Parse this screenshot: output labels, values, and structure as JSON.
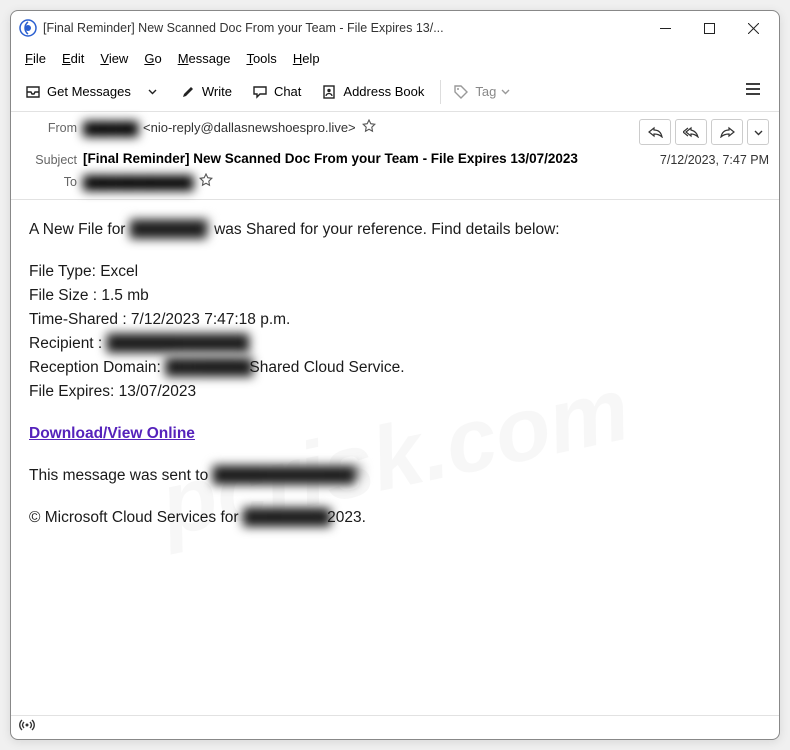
{
  "window": {
    "title": "[Final Reminder] New Scanned Doc From your Team - File Expires 13/..."
  },
  "menubar": {
    "file": "File",
    "edit": "Edit",
    "view": "View",
    "go": "Go",
    "message": "Message",
    "tools": "Tools",
    "help": "Help"
  },
  "toolbar": {
    "get_messages": "Get Messages",
    "write": "Write",
    "chat": "Chat",
    "address_book": "Address Book",
    "tag": "Tag"
  },
  "headers": {
    "from_label": "From",
    "from_name_blur": "██████",
    "from_addr": "<nio-reply@dallasnewshoespro.live>",
    "subject_label": "Subject",
    "subject": "[Final Reminder] New Scanned Doc From your Team - File Expires 13/07/2023",
    "to_label": "To",
    "to_blur": "████████████",
    "timestamp": "7/12/2023, 7:47 PM"
  },
  "body": {
    "line1a": "A New File for ",
    "line1_blur": "███████",
    "line1b": " was Shared for your reference. Find details below:",
    "file_type": "File Type: Excel",
    "file_size": "File Size : 1.5 mb",
    "time_shared": "Time-Shared : 7/12/2023 7:47:18 p.m.",
    "recipient_label": "Recipient : ",
    "recipient_blur": "█████████████",
    "reception_label": "Reception Domain: ",
    "reception_blur": "████████",
    "reception_suffix": " Shared Cloud Service.",
    "file_expires": "File Expires: 13/07/2023",
    "download": "Download/View Online",
    "sent_to_label": "This message was sent to ",
    "sent_to_blur": "█████████████",
    "copyright_a": "© Microsoft Cloud Services for ",
    "copyright_blur": "████████",
    "copyright_b": " 2023."
  }
}
